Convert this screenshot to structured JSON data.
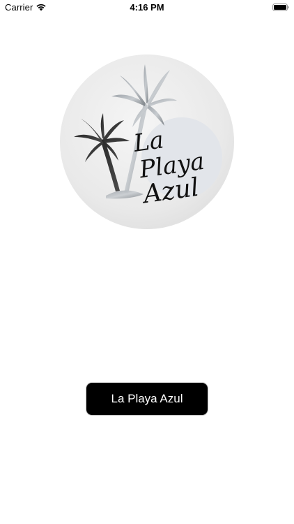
{
  "status_bar": {
    "carrier": "Carrier",
    "time": "4:16 PM"
  },
  "logo": {
    "line1": "La",
    "line2": "Playa",
    "line3": "Azul"
  },
  "main_button": {
    "label": "La Playa Azul"
  },
  "colors": {
    "button_background": "#000000",
    "button_text": "#ffffff",
    "background": "#ffffff"
  }
}
